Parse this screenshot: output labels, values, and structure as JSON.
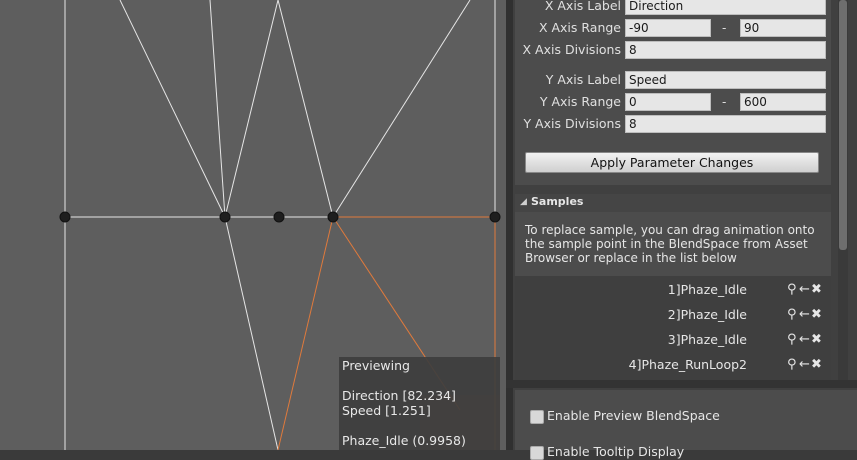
{
  "grid": {
    "corner_tag": "",
    "preview": {
      "title": "Previewing",
      "direction": "Direction [82.234]",
      "speed": "Speed [1.251]",
      "sample_weight": "Phaze_Idle (0.9958)"
    }
  },
  "params": {
    "x_label": {
      "label": "X Axis Label",
      "value": "Direction"
    },
    "x_range": {
      "label": "X Axis Range",
      "min": "-90",
      "sep": "-",
      "max": "90"
    },
    "x_divisions": {
      "label": "X Axis Divisions",
      "value": "8"
    },
    "y_label": {
      "label": "Y Axis Label",
      "value": "Speed"
    },
    "y_range": {
      "label": "Y Axis Range",
      "min": "0",
      "sep": "-",
      "max": "600"
    },
    "y_divisions": {
      "label": "Y Axis Divisions",
      "value": "8"
    },
    "apply_button": "Apply Parameter Changes"
  },
  "samples": {
    "header": "Samples",
    "description": "To replace sample, you can drag animation onto the sample point in the BlendSpace from Asset Browser or replace in the list below",
    "items": [
      {
        "name": "1]Phaze_Idle"
      },
      {
        "name": "2]Phaze_Idle"
      },
      {
        "name": "3]Phaze_Idle"
      },
      {
        "name": "4]Phaze_RunLoop2"
      }
    ],
    "icons": {
      "find": "⚲",
      "use": "←",
      "remove": "✖"
    }
  },
  "options": {
    "enable_preview": "Enable Preview BlendSpace",
    "enable_tooltip": "Enable Tooltip Display"
  },
  "colors": {
    "grid_bg": "#5e5e5e",
    "grid_line": "#e6e6e6",
    "highlight": "#e07a3c",
    "panel_bg": "#4c4c4c",
    "field_bg": "#e6e6e6"
  }
}
